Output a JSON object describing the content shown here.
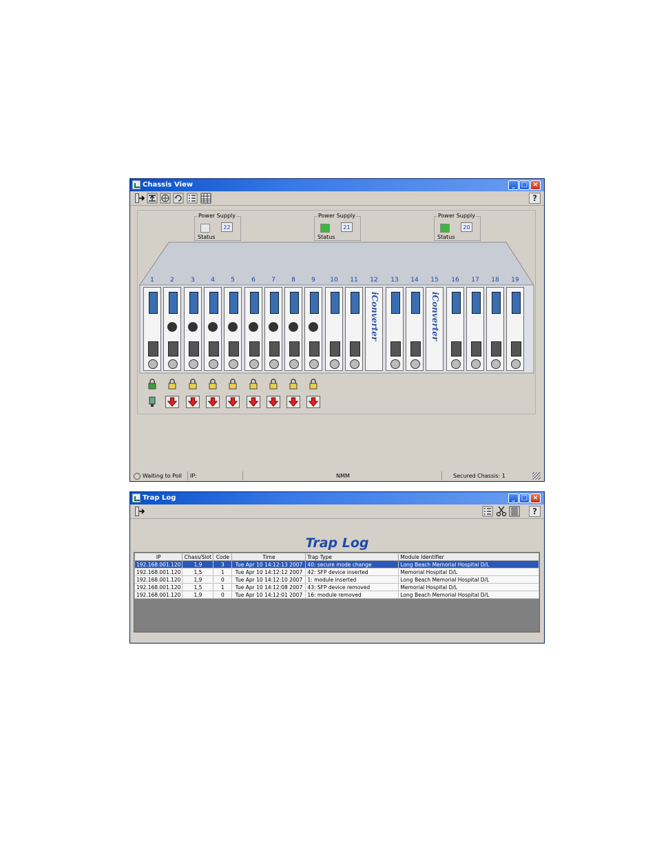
{
  "chassis_window": {
    "title": "Chassis View",
    "help_label": "?",
    "window_buttons": {
      "minimize": "_",
      "maximize": "□",
      "close": "×"
    },
    "toolbar_icons": [
      "exit-icon",
      "upload-icon",
      "network-icon",
      "refresh-icon",
      "list-icon",
      "grid-icon"
    ],
    "power_supplies": [
      {
        "label": "Power Supply",
        "status_label": "Status",
        "number": "22",
        "status_color": "#e8e8e8"
      },
      {
        "label": "Power Supply",
        "status_label": "Status",
        "number": "21",
        "status_color": "#3ab83a"
      },
      {
        "label": "Power Supply",
        "status_label": "Status",
        "number": "20",
        "status_color": "#3ab83a"
      }
    ],
    "slots": [
      "1",
      "2",
      "3",
      "4",
      "5",
      "6",
      "7",
      "8",
      "9",
      "10",
      "11",
      "12",
      "13",
      "14",
      "15",
      "16",
      "17",
      "18",
      "19"
    ],
    "card_brand": "iConverter",
    "status_bar": {
      "poll": "Waiting to Poll",
      "ip": "IP:",
      "mode": "NMM",
      "secured": "Secured Chassis: 1"
    }
  },
  "trap_window": {
    "title": "Trap Log",
    "heading": "Trap Log",
    "help_label": "?",
    "window_buttons": {
      "minimize": "_",
      "maximize": "□",
      "close": "×"
    },
    "columns": [
      "IP",
      "Chass/Slot",
      "Code",
      "Time",
      "Trap Type",
      "Module Identifier"
    ],
    "rows": [
      {
        "ip": "192.168.001.120",
        "slot": "1,9",
        "code": "3",
        "time": "Tue Apr 10 14:12:13 2007",
        "type": "40: secure mode change",
        "module": "Long Beach Memorial Hospital D/L"
      },
      {
        "ip": "192.168.001.120",
        "slot": "1,5",
        "code": "1",
        "time": "Tue Apr 10 14:12:12 2007",
        "type": "42: SFP device inserted",
        "module": "Memorial Hospital D/L"
      },
      {
        "ip": "192.168.001.120",
        "slot": "1,9",
        "code": "0",
        "time": "Tue Apr 10 14:12:10 2007",
        "type": "1: module inserted",
        "module": "Long Beach Memorial Hospital D/L"
      },
      {
        "ip": "192.168.001.120",
        "slot": "1,5",
        "code": "1",
        "time": "Tue Apr 10 14:12:08 2007",
        "type": "43: SFP device removed",
        "module": "Memorial Hospital D/L"
      },
      {
        "ip": "192.168.001.120",
        "slot": "1,9",
        "code": "0",
        "time": "Tue Apr 10 14:12:01 2007",
        "type": "16: module removed",
        "module": "Long Beach Memorial Hospital D/L"
      }
    ]
  }
}
